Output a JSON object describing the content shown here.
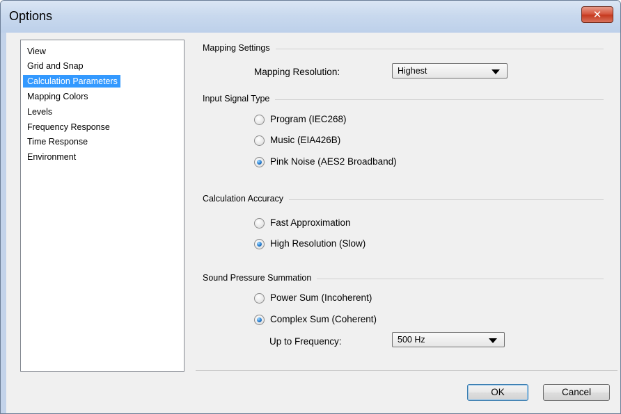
{
  "window": {
    "title": "Options",
    "close_glyph": "✕"
  },
  "nav": {
    "items": [
      {
        "label": "View",
        "selected": false
      },
      {
        "label": "Grid and Snap",
        "selected": false
      },
      {
        "label": "Calculation Parameters",
        "selected": true
      },
      {
        "label": "Mapping Colors",
        "selected": false
      },
      {
        "label": "Levels",
        "selected": false
      },
      {
        "label": "Frequency Response",
        "selected": false
      },
      {
        "label": "Time Response",
        "selected": false
      },
      {
        "label": "Environment",
        "selected": false
      }
    ]
  },
  "mapping": {
    "group_label": "Mapping Settings",
    "resolution_label": "Mapping Resolution:",
    "resolution_value": "Highest"
  },
  "input_signal": {
    "group_label": "Input Signal Type",
    "options": [
      {
        "label": "Program (IEC268)",
        "checked": false
      },
      {
        "label": "Music (EIA426B)",
        "checked": false
      },
      {
        "label": "Pink Noise (AES2 Broadband)",
        "checked": true
      }
    ]
  },
  "accuracy": {
    "group_label": "Calculation Accuracy",
    "options": [
      {
        "label": "Fast Approximation",
        "checked": false
      },
      {
        "label": "High Resolution (Slow)",
        "checked": true
      }
    ]
  },
  "summation": {
    "group_label": "Sound Pressure Summation",
    "options": [
      {
        "label": "Power Sum (Incoherent)",
        "checked": false
      },
      {
        "label": "Complex Sum (Coherent)",
        "checked": true
      }
    ],
    "frequency_label": "Up to Frequency:",
    "frequency_value": "500 Hz"
  },
  "buttons": {
    "ok": "OK",
    "cancel": "Cancel"
  }
}
